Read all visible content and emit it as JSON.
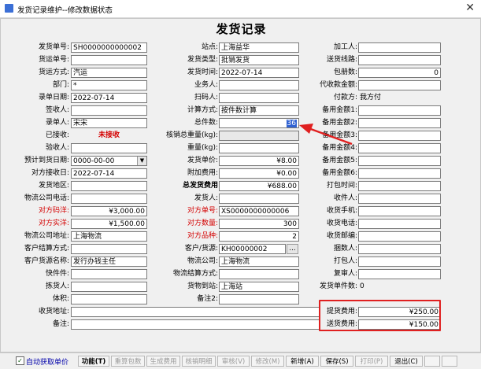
{
  "window": {
    "title": "发货记录维护--修改数据状态",
    "close_glyph": "✕"
  },
  "form": {
    "heading": "发货记录"
  },
  "col1": {
    "shipment_no": {
      "label": "发货单号:",
      "value": "SH0000000000002"
    },
    "waybill_no": {
      "label": "货运单号:",
      "value": ""
    },
    "transport_mode": {
      "label": "货运方式:",
      "value": "汽运"
    },
    "department": {
      "label": "部门:",
      "value": "*"
    },
    "entry_date": {
      "label": "录单日期:",
      "value": "2022-07-14"
    },
    "signer": {
      "label": "签收人:",
      "value": ""
    },
    "entry_person": {
      "label": "录单人:",
      "value": "宋宋"
    },
    "received": {
      "label": "已接收:",
      "value": "未接收"
    },
    "inspector": {
      "label": "验收人:",
      "value": ""
    },
    "expected_arrival": {
      "label": "预计到货日期:",
      "value": "0000-00-00"
    },
    "peer_receive_date": {
      "label": "对方接收日:",
      "value": "2022-07-14"
    },
    "ship_region": {
      "label": "发货地区:",
      "value": ""
    },
    "logistics_phone": {
      "label": "物流公司电话:",
      "value": ""
    },
    "peer_code_price": {
      "label": "对方码洋:",
      "value": "¥3,000.00"
    },
    "peer_actual_price": {
      "label": "对方实洋:",
      "value": "¥1,500.00"
    },
    "logistics_address": {
      "label": "物流公司地址:",
      "value": "上海物流"
    },
    "settle_mode": {
      "label": "客户结算方式:",
      "value": ""
    },
    "source_name": {
      "label": "客户货源名称:",
      "value": "发行办钱主任"
    },
    "fast_parts": {
      "label": "快件件:",
      "value": ""
    },
    "packer": {
      "label": "拣货人:",
      "value": ""
    },
    "volume": {
      "label": "体积:",
      "value": ""
    },
    "receive_address": {
      "label": "收货地址:",
      "value": ""
    },
    "remark": {
      "label": "备注:",
      "value": ""
    }
  },
  "col2": {
    "station": {
      "label": "站点:",
      "value": "上海益华"
    },
    "ship_type": {
      "label": "发货类型:",
      "value": "批销发货"
    },
    "ship_time": {
      "label": "发货时间:",
      "value": "2022-07-14"
    },
    "operator": {
      "label": "业务人:",
      "value": ""
    },
    "scanner": {
      "label": "扫码人:",
      "value": ""
    },
    "calc_mode": {
      "label": "计算方式:",
      "value": "按件数计算"
    },
    "total_count": {
      "label": "总件数:",
      "value": "36"
    },
    "verified_weight": {
      "label": "核销总重量(kg):",
      "value": ""
    },
    "weight": {
      "label": "重量(kg):",
      "value": ""
    },
    "ship_unit_price": {
      "label": "发货单价:",
      "value": "¥8.00"
    },
    "extra_fee": {
      "label": "附加费用:",
      "value": "¥0.00"
    },
    "total_ship_fee": {
      "label": "总发货费用",
      "value": "¥688.00"
    },
    "shipper": {
      "label": "发货人:",
      "value": ""
    },
    "peer_order_no": {
      "label": "对方单号:",
      "value": "XS0000000000006"
    },
    "peer_quantity": {
      "label": "对方数量:",
      "value": "300"
    },
    "peer_variety": {
      "label": "对方品种:",
      "value": "2"
    },
    "customer_source": {
      "label": "客户/货源:",
      "value": "KH00000002",
      "button": "..."
    },
    "logistics_company": {
      "label": "物流公司:",
      "value": "上海物流"
    },
    "logistics_settle": {
      "label": "物流结算方式:",
      "value": ""
    },
    "cargo_to_station": {
      "label": "货物到站:",
      "value": "上海站"
    },
    "remark2": {
      "label": "备注2:",
      "value": ""
    }
  },
  "col3": {
    "processor": {
      "label": "加工人:",
      "value": ""
    },
    "route": {
      "label": "送货线路:",
      "value": ""
    },
    "package_count": {
      "label": "包册数:",
      "value": "0"
    },
    "cod_amount": {
      "label": "代收款金额:",
      "value": ""
    },
    "payer": {
      "label": "付款方:",
      "value": "我方付"
    },
    "spare1": {
      "label": "备用金额1:",
      "value": ""
    },
    "spare2": {
      "label": "备用金额2:",
      "value": ""
    },
    "spare3": {
      "label": "备用金额3:",
      "value": ""
    },
    "spare4": {
      "label": "备用金额4:",
      "value": ""
    },
    "spare5": {
      "label": "备用金额5:",
      "value": ""
    },
    "spare6": {
      "label": "备用金额6:",
      "value": ""
    },
    "print_time": {
      "label": "打包时间:",
      "value": ""
    },
    "receiver": {
      "label": "收件人:",
      "value": ""
    },
    "receiver_mobile": {
      "label": "收货手机:",
      "value": ""
    },
    "receiver_phone": {
      "label": "收货电话:",
      "value": ""
    },
    "receiver_postcode": {
      "label": "收货邮编:",
      "value": ""
    },
    "pack_count": {
      "label": "捆数人:",
      "value": ""
    },
    "packager": {
      "label": "打包人:",
      "value": ""
    },
    "reviewer": {
      "label": "复审人:",
      "value": ""
    },
    "ship_item_count": {
      "label": "发货单件数:",
      "value": "0"
    },
    "pickup_fee": {
      "label": "提货费用:",
      "value": "¥250.00"
    },
    "delivery_fee": {
      "label": "送货费用:",
      "value": "¥150.00"
    }
  },
  "toolbar": {
    "auto_price_label": "自动获取单价",
    "auto_price_check": "✓",
    "function": "功能(T)",
    "recalc_pack": "重算包数",
    "gen_fee": "生成费用",
    "verify_detail": "核销明细",
    "review": "审核(V)",
    "edit": "修改(M)",
    "new": "新增(A)",
    "save": "保存(S)",
    "print": "打印(P)",
    "exit": "退出(C)"
  },
  "colors": {
    "highlight_box": "#e02020",
    "selection": "#3062d2",
    "required_label": "#d40000"
  }
}
